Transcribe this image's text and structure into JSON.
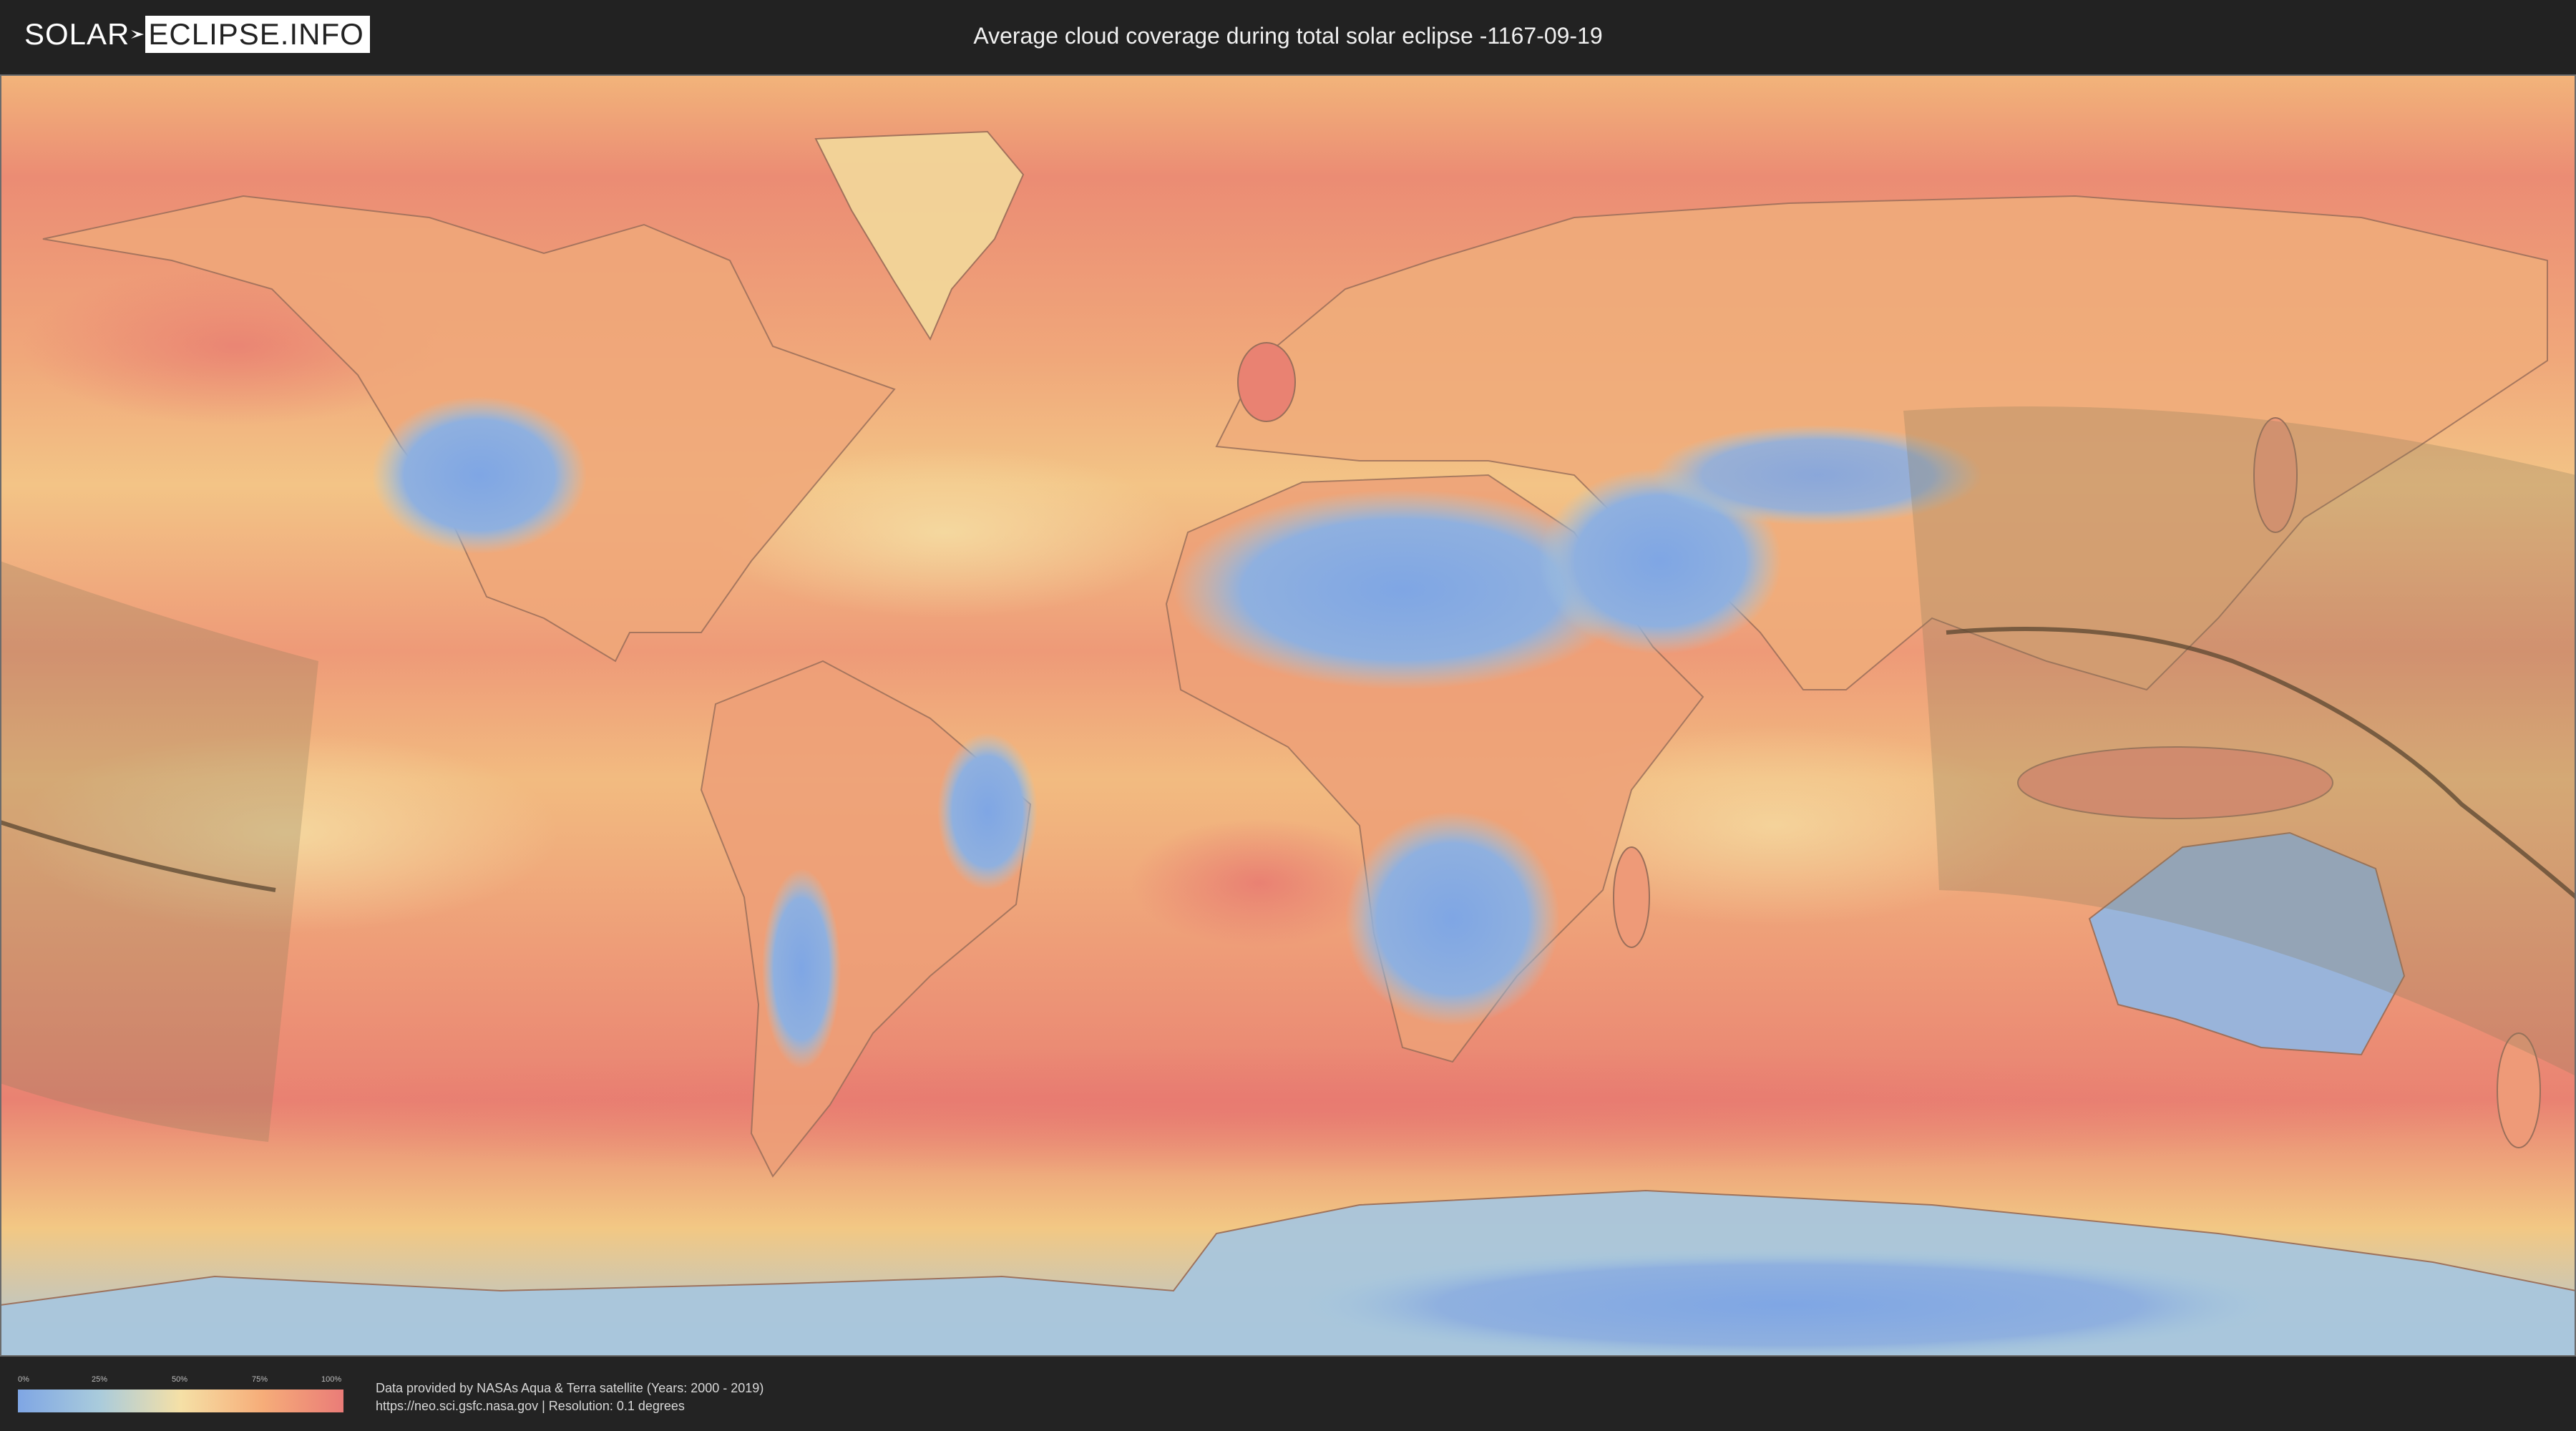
{
  "header": {
    "logo_left": "SOLAR",
    "logo_right": "ECLIPSE.INFO",
    "title": "Average cloud coverage during total solar eclipse -1167-09-19"
  },
  "legend": {
    "ticks": [
      "0%",
      "25%",
      "50%",
      "75%",
      "100%"
    ],
    "colors": [
      "#7fa6e4",
      "#a9cbdc",
      "#f5e0a6",
      "#f6ad79",
      "#ea7c78"
    ]
  },
  "credits": {
    "line1": "Data provided by NASAs Aqua & Terra satellite (Years: 2000 - 2019)",
    "line2": "https://neo.sci.gsfc.nasa.gov | Resolution: 0.1 degrees"
  },
  "colors": {
    "low_cloud": "#7fa6e4",
    "mid_cloud": "#f5e0a6",
    "high_cloud": "#ea7c78",
    "eclipse_band": "#8a7a5a",
    "central_line": "#5a4630"
  }
}
